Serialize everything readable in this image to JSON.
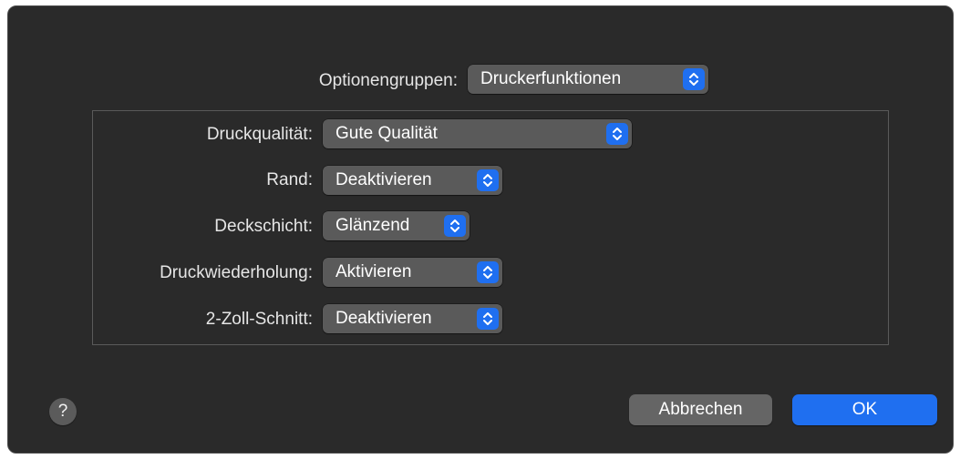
{
  "dialog": {
    "option_group_label": "Optionengruppen:",
    "option_group_value": "Druckerfunktionen",
    "settings": {
      "quality_label": "Druckqualität:",
      "quality_value": "Gute Qualität",
      "border_label": "Rand:",
      "border_value": "Deaktivieren",
      "coating_label": "Deckschicht:",
      "coating_value": "Glänzend",
      "repeat_label": "Druckwiederholung:",
      "repeat_value": "Aktivieren",
      "cut_label": "2-Zoll-Schnitt:",
      "cut_value": "Deaktivieren"
    },
    "help_label": "?",
    "cancel_label": "Abbrechen",
    "ok_label": "OK"
  },
  "colors": {
    "dialog_bg": "#2a2a2a",
    "popup_bg": "#5a5a5a",
    "accent": "#1f6ff0",
    "text": "#e6e6e6"
  },
  "icons": {
    "stepper": "chevron-up-down-icon",
    "help": "question-mark-icon"
  }
}
